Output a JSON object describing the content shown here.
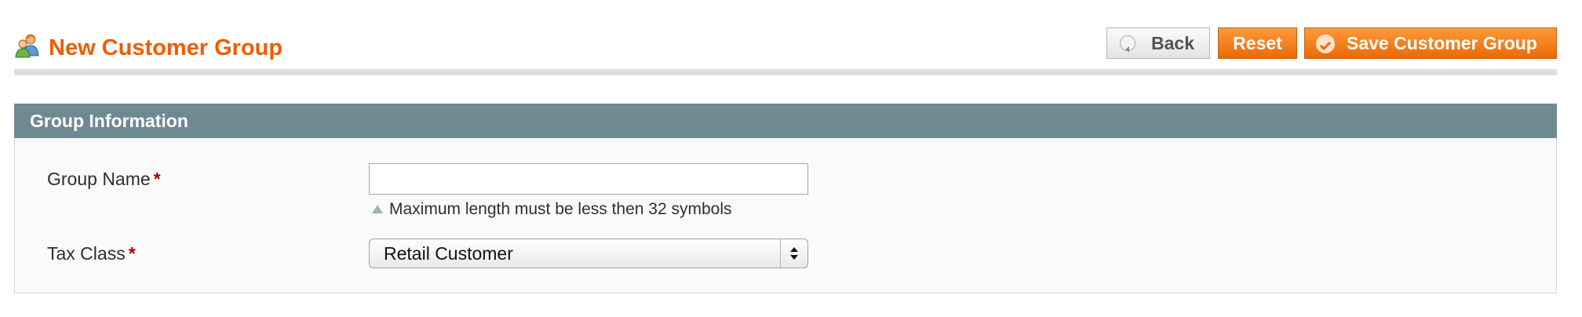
{
  "page": {
    "title": "New Customer Group",
    "icon": "customer-group-icon"
  },
  "buttons": {
    "back_label": "Back",
    "reset_label": "Reset",
    "save_label": "Save Customer Group"
  },
  "fieldset": {
    "title": "Group Information",
    "group_name": {
      "label": "Group Name",
      "required_mark": "*",
      "value": "",
      "hint": "Maximum length must be less then 32 symbols"
    },
    "tax_class": {
      "label": "Tax Class",
      "required_mark": "*",
      "selected": "Retail Customer"
    }
  },
  "colors": {
    "title_orange": "#eb5e00",
    "button_orange": "#f37b1d",
    "fieldset_header": "#6f8992",
    "required_red": "#b30000"
  }
}
